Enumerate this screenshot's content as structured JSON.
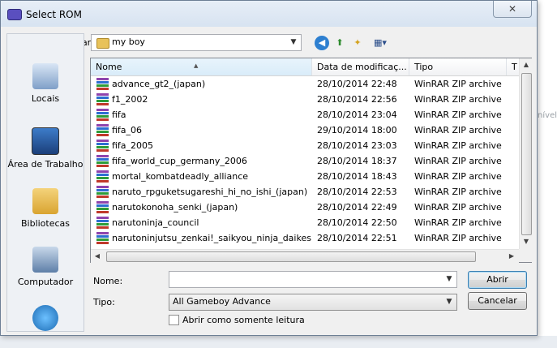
{
  "window": {
    "title": "Select ROM",
    "close_glyph": "✕"
  },
  "background_hint": "nível",
  "lookin": {
    "label": "Examinar:",
    "value": "my boy"
  },
  "toolbar": {
    "icons": [
      "back-icon",
      "up-folder-icon",
      "new-folder-icon",
      "view-menu-icon"
    ]
  },
  "places": [
    {
      "name": "recent-places",
      "label": "Locais"
    },
    {
      "name": "desktop",
      "label": "Área de Trabalho"
    },
    {
      "name": "libraries",
      "label": "Bibliotecas"
    },
    {
      "name": "computer",
      "label": "Computador"
    },
    {
      "name": "network",
      "label": ""
    }
  ],
  "columns": [
    "Nome",
    "Data de modificaç...",
    "Tipo",
    "T"
  ],
  "files": [
    {
      "name": "advance_gt2_(japan)",
      "date": "28/10/2014 22:48",
      "type": "WinRAR ZIP archive"
    },
    {
      "name": "f1_2002",
      "date": "28/10/2014 22:56",
      "type": "WinRAR ZIP archive"
    },
    {
      "name": "fifa",
      "date": "28/10/2014 23:04",
      "type": "WinRAR ZIP archive"
    },
    {
      "name": "fifa_06",
      "date": "29/10/2014 18:00",
      "type": "WinRAR ZIP archive"
    },
    {
      "name": "fifa_2005",
      "date": "28/10/2014 23:03",
      "type": "WinRAR ZIP archive"
    },
    {
      "name": "fifa_world_cup_germany_2006",
      "date": "28/10/2014 18:37",
      "type": "WinRAR ZIP archive"
    },
    {
      "name": "mortal_kombatdeadly_alliance",
      "date": "28/10/2014 18:43",
      "type": "WinRAR ZIP archive"
    },
    {
      "name": "naruto_rpguketsugareshi_hi_no_ishi_(japan)",
      "date": "28/10/2014 22:53",
      "type": "WinRAR ZIP archive"
    },
    {
      "name": "narutokonoha_senki_(japan)",
      "date": "28/10/2014 22:49",
      "type": "WinRAR ZIP archive"
    },
    {
      "name": "narutoninja_council",
      "date": "28/10/2014 22:50",
      "type": "WinRAR ZIP archive"
    },
    {
      "name": "narutoninjutsu_zenkai!_saikyou_ninja_daikes...",
      "date": "28/10/2014 22:51",
      "type": "WinRAR ZIP archive"
    }
  ],
  "filename": {
    "label": "Nome:",
    "value": ""
  },
  "filetype": {
    "label": "Tipo:",
    "value": "All Gameboy Advance"
  },
  "readonly": {
    "label": "Abrir como somente leitura",
    "checked": false
  },
  "buttons": {
    "open": "Abrir",
    "cancel": "Cancelar"
  }
}
